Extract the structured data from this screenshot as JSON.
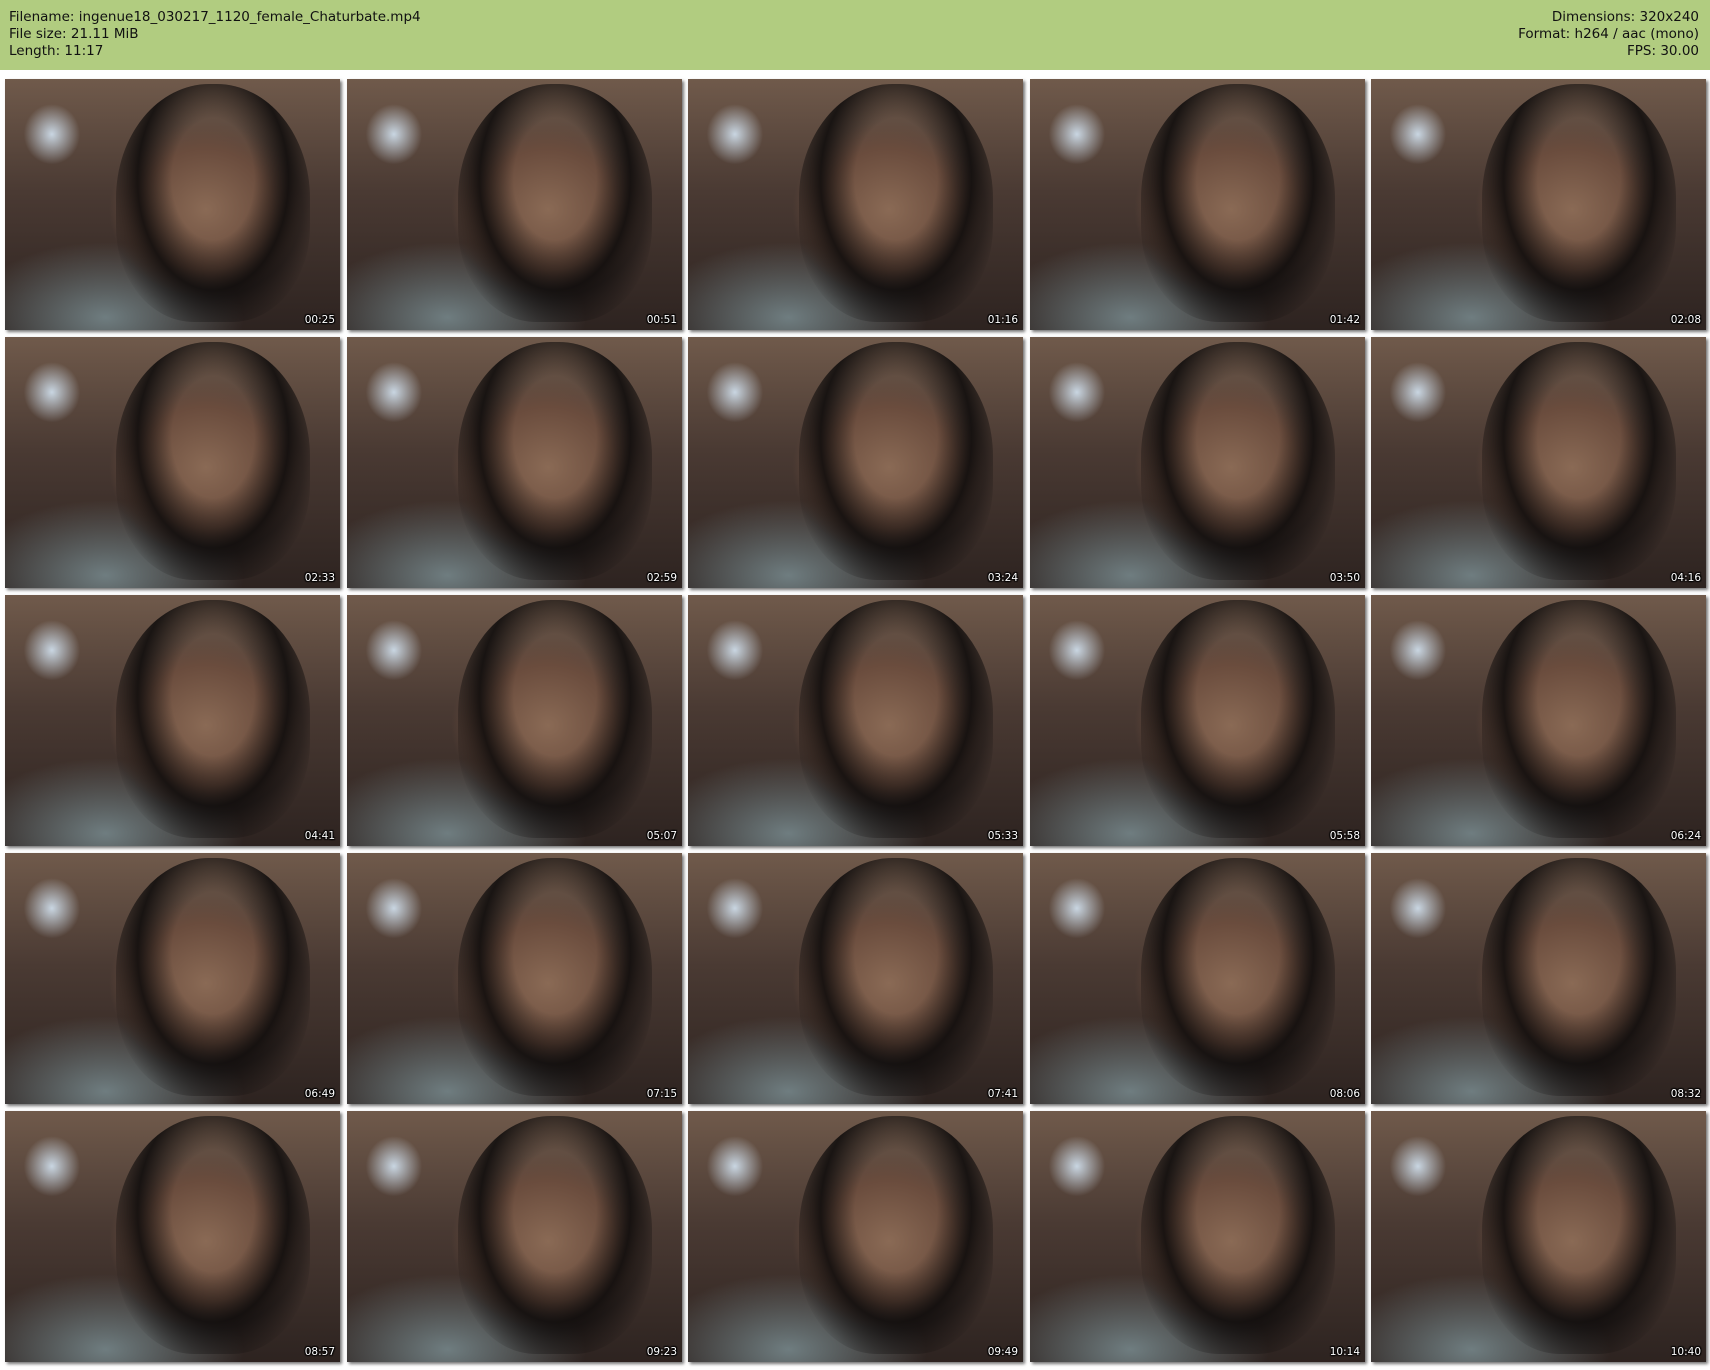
{
  "header": {
    "filename_line": "Filename: ingenue18_030217_1120_female_Chaturbate.mp4",
    "filesize_line": "File size: 21.11 MiB",
    "length_line": "Length: 11:17",
    "dimensions_line": "Dimensions: 320x240",
    "format_line": "Format: h264 / aac (mono)",
    "fps_line": "FPS: 30.00"
  },
  "colors": {
    "header_background": "#b1cc80",
    "page_background": "#ffffff"
  },
  "thumbnails": [
    {
      "timestamp": "00:25"
    },
    {
      "timestamp": "00:51"
    },
    {
      "timestamp": "01:16"
    },
    {
      "timestamp": "01:42"
    },
    {
      "timestamp": "02:08"
    },
    {
      "timestamp": "02:33"
    },
    {
      "timestamp": "02:59"
    },
    {
      "timestamp": "03:24"
    },
    {
      "timestamp": "03:50"
    },
    {
      "timestamp": "04:16"
    },
    {
      "timestamp": "04:41"
    },
    {
      "timestamp": "05:07"
    },
    {
      "timestamp": "05:33"
    },
    {
      "timestamp": "05:58"
    },
    {
      "timestamp": "06:24"
    },
    {
      "timestamp": "06:49"
    },
    {
      "timestamp": "07:15"
    },
    {
      "timestamp": "07:41"
    },
    {
      "timestamp": "08:06"
    },
    {
      "timestamp": "08:32"
    },
    {
      "timestamp": "08:57"
    },
    {
      "timestamp": "09:23"
    },
    {
      "timestamp": "09:49"
    },
    {
      "timestamp": "10:14"
    },
    {
      "timestamp": "10:40"
    }
  ]
}
